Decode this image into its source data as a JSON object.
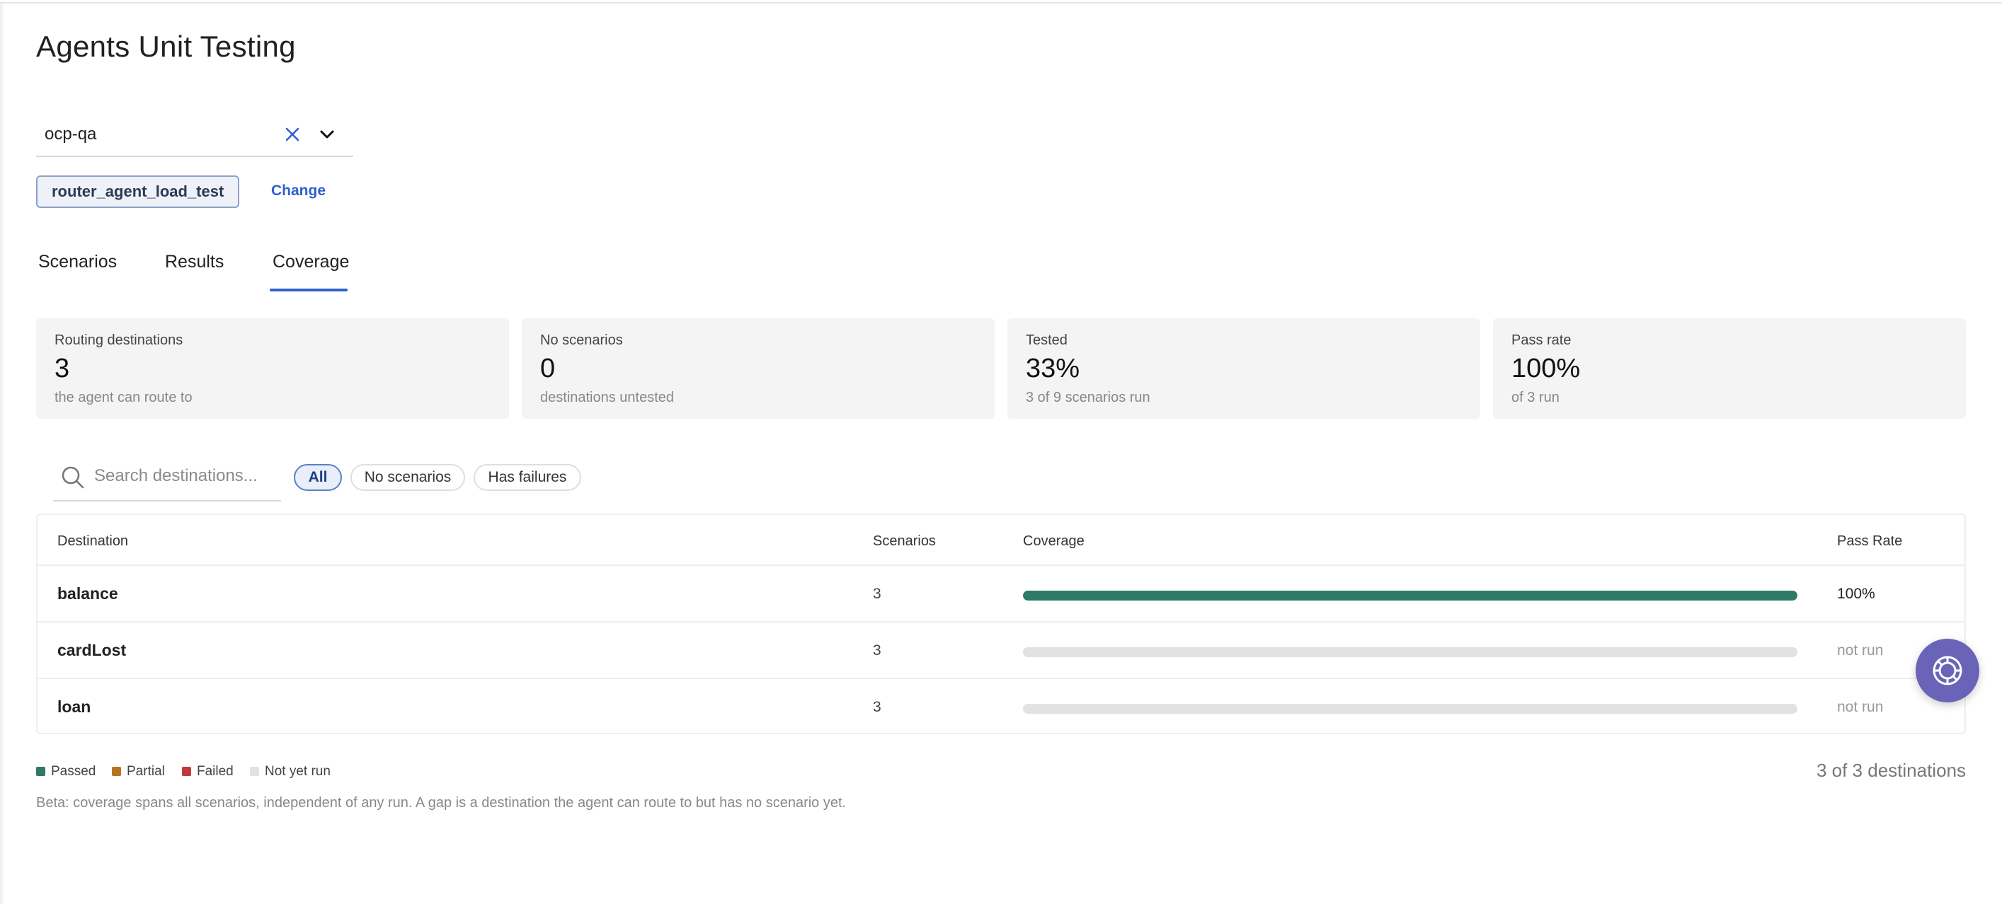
{
  "page": {
    "title": "Agents Unit Testing"
  },
  "project_selector": {
    "value": "ocp-qa"
  },
  "agent": {
    "name": "router_agent_load_test",
    "change_label": "Change"
  },
  "tabs": [
    {
      "label": "Scenarios",
      "active": false
    },
    {
      "label": "Results",
      "active": false
    },
    {
      "label": "Coverage",
      "active": true
    }
  ],
  "stats": [
    {
      "label": "Routing destinations",
      "value": "3",
      "sub": "the agent can route to"
    },
    {
      "label": "No scenarios",
      "value": "0",
      "sub": "destinations untested"
    },
    {
      "label": "Tested",
      "value": "33%",
      "sub": "3 of 9 scenarios run"
    },
    {
      "label": "Pass rate",
      "value": "100%",
      "sub": "of 3 run"
    }
  ],
  "search": {
    "placeholder": "Search destinations..."
  },
  "filters": [
    {
      "label": "All",
      "active": true
    },
    {
      "label": "No scenarios",
      "active": false
    },
    {
      "label": "Has failures",
      "active": false
    }
  ],
  "table": {
    "headers": [
      "Destination",
      "Scenarios",
      "Coverage",
      "Pass Rate"
    ],
    "rows": [
      {
        "destination": "balance",
        "scenarios": "3",
        "coverage_passed_fraction": 1.0,
        "pass_rate": "100%"
      },
      {
        "destination": "cardLost",
        "scenarios": "3",
        "coverage_passed_fraction": 0.0,
        "pass_rate": "not run"
      },
      {
        "destination": "loan",
        "scenarios": "3",
        "coverage_passed_fraction": 0.0,
        "pass_rate": "not run"
      }
    ]
  },
  "legend": [
    {
      "label": "Passed",
      "color": "#2f7a67"
    },
    {
      "label": "Partial",
      "color": "#b8731e"
    },
    {
      "label": "Failed",
      "color": "#c03a3a"
    },
    {
      "label": "Not yet run",
      "color": "#e2e2e2"
    }
  ],
  "footer": {
    "count": "3 of 3 destinations",
    "note": "Beta: coverage spans all scenarios, independent of any run. A gap is a destination the agent can route to but has no scenario yet."
  },
  "colors": {
    "accent": "#2f5fd0",
    "passed": "#2f7a67",
    "not_run_bar": "#e2e2e2",
    "help_button": "#6a64b8"
  },
  "icons": {
    "clear": "close-icon",
    "dropdown": "chevron-down-icon",
    "search": "search-icon",
    "help": "support-icon"
  }
}
